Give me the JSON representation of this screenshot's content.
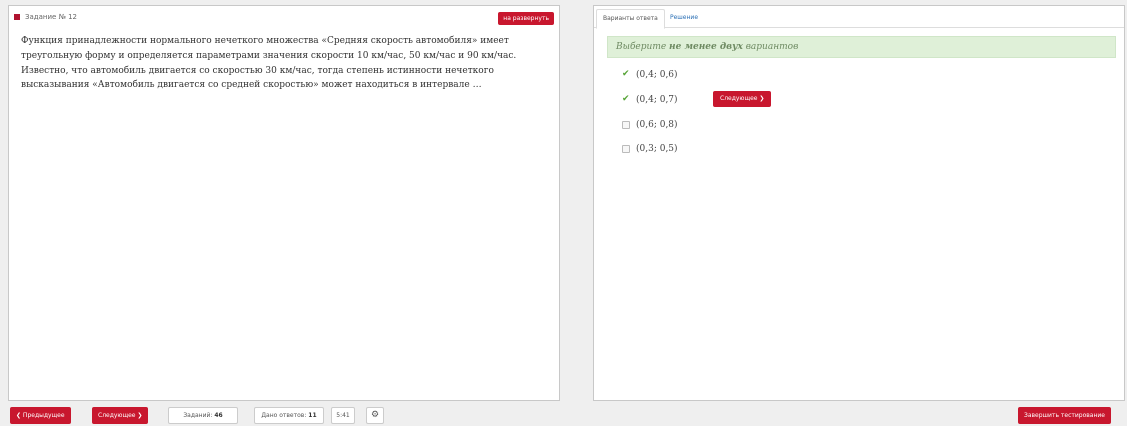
{
  "task": {
    "title": "Задание № 12",
    "expand_label": "на развернуть",
    "question": "Функция принадлежности нормального нечеткого множества «Средняя скорость автомобиля» имеет треугольную форму и определяется параметрами значения скорости 10 км/час, 50 км/час и 90 км/час. Известно, что автомобиль двигается со скоростью 30 км/час, тогда степень истинности нечеткого высказывания «Автомобиль двигается со средней скоростью» может находиться в интервале …"
  },
  "tabs": [
    {
      "label": "Варианты ответа",
      "active": true
    },
    {
      "label": "Решение",
      "active": false
    }
  ],
  "hint": {
    "prefix": "Выберите ",
    "emphasis": "не менее двух",
    "suffix": " вариантов"
  },
  "options": [
    {
      "label": "(0,4; 0,6)",
      "checked": true
    },
    {
      "label": "(0,4; 0,7)",
      "checked": true
    },
    {
      "label": "(0,6; 0,8)",
      "checked": false
    },
    {
      "label": "(0,3; 0,5)",
      "checked": false
    }
  ],
  "inline_next_label": "Следующее ❯",
  "bottom": {
    "prev_label": "❮ Предыдущее",
    "next_label": "Следующее ❯",
    "tasks_label": "Заданий:",
    "tasks_value": "46",
    "answers_label": "Дано ответов:",
    "answers_value": "11",
    "timer": "5:41",
    "finish_label": "Завершить тестирование"
  },
  "colors": {
    "accent_red": "#c8172e",
    "hint_bg": "#dff0d8",
    "check_green": "#55a335",
    "link_blue": "#2a6fb5"
  }
}
